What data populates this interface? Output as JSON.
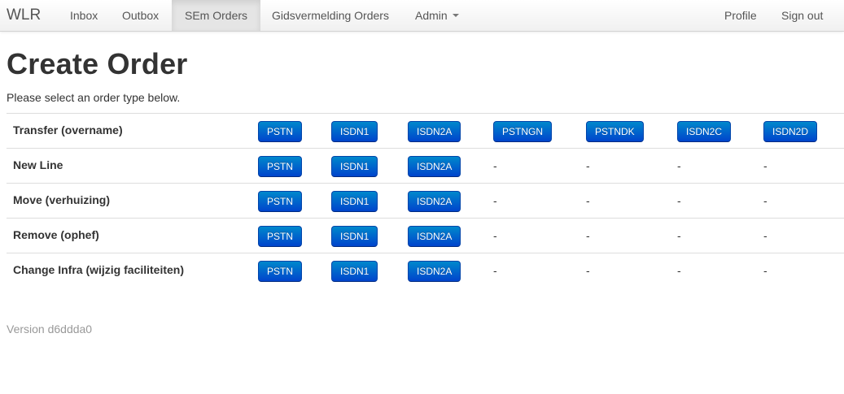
{
  "navbar": {
    "brand": "WLR",
    "items": [
      {
        "label": "Inbox"
      },
      {
        "label": "Outbox"
      },
      {
        "label": "SEm Orders",
        "active": true
      },
      {
        "label": "Gidsvermelding Orders"
      },
      {
        "label": "Admin"
      }
    ],
    "right_items": [
      {
        "label": "Profile"
      },
      {
        "label": "Sign out"
      }
    ]
  },
  "page": {
    "title": "Create Order",
    "subtitle": "Please select an order type below.",
    "version": "Version d6ddda0"
  },
  "order_types": [
    {
      "label": "Transfer (overname)",
      "cells": [
        "PSTN",
        "ISDN1",
        "ISDN2A",
        "PSTNGN",
        "PSTNDK",
        "ISDN2C",
        "ISDN2D"
      ]
    },
    {
      "label": "New Line",
      "cells": [
        "PSTN",
        "ISDN1",
        "ISDN2A",
        "-",
        "-",
        "-",
        "-"
      ]
    },
    {
      "label": "Move (verhuizing)",
      "cells": [
        "PSTN",
        "ISDN1",
        "ISDN2A",
        "-",
        "-",
        "-",
        "-"
      ]
    },
    {
      "label": "Remove (ophef)",
      "cells": [
        "PSTN",
        "ISDN1",
        "ISDN2A",
        "-",
        "-",
        "-",
        "-"
      ]
    },
    {
      "label": "Change Infra (wijzig faciliteiten)",
      "cells": [
        "PSTN",
        "ISDN1",
        "ISDN2A",
        "-",
        "-",
        "-",
        "-"
      ]
    }
  ],
  "colors": {
    "button_top": "#0088cc",
    "button_bottom": "#0044cc",
    "muted_text": "#999999"
  }
}
